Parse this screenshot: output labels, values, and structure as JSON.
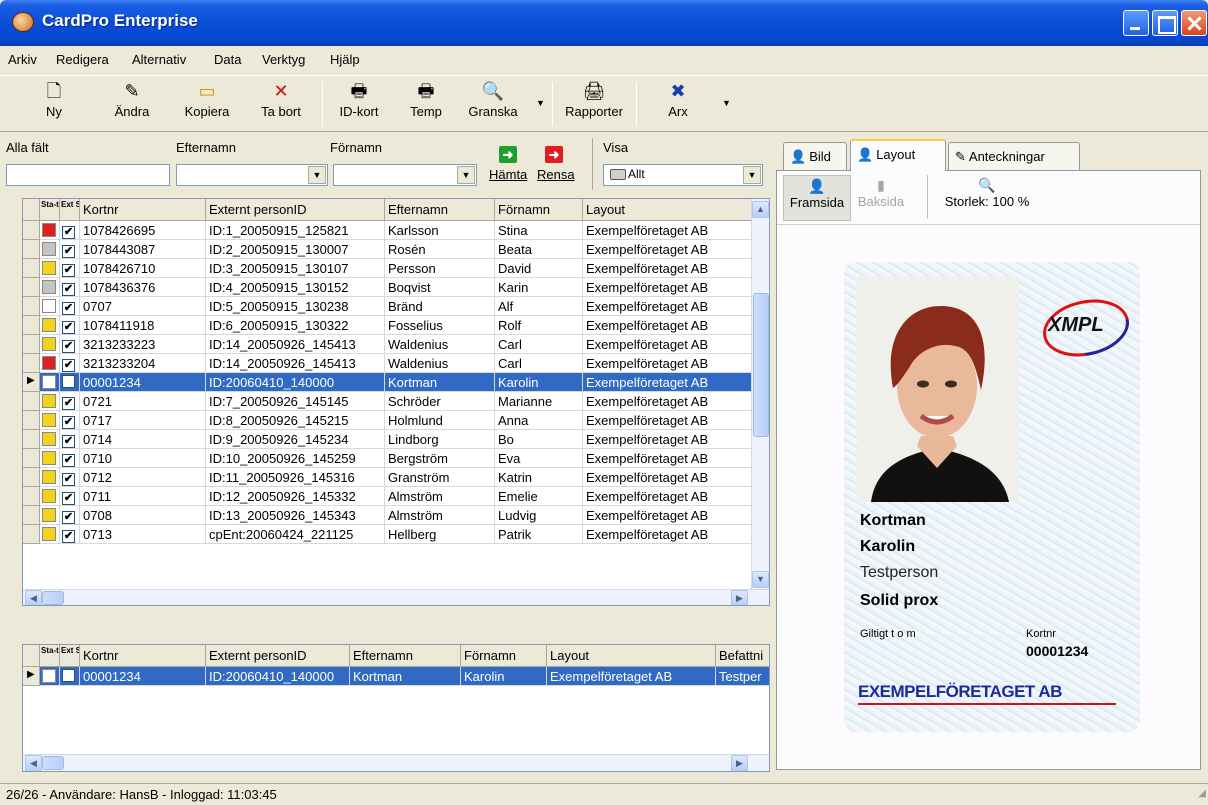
{
  "window": {
    "title": "CardPro Enterprise"
  },
  "menu": [
    "Arkiv",
    "Redigera",
    "Alternativ",
    "Data",
    "Verktyg",
    "Hjälp"
  ],
  "toolbar": {
    "new": "Ny",
    "edit": "Ändra",
    "copy": "Kopiera",
    "delete": "Ta bort",
    "idcard": "ID-kort",
    "temp": "Temp",
    "preview": "Granska",
    "reports": "Rapporter",
    "arx": "Arx"
  },
  "filter": {
    "all_fields_label": "Alla fält",
    "lastname_label": "Efternamn",
    "firstname_label": "Förnamn",
    "fetch": "Hämta",
    "clear": "Rensa",
    "show_label": "Visa",
    "show_value": "Allt"
  },
  "grid_headers": {
    "status": "Sta-tus",
    "ext_sync": "Ext Sync",
    "cardno": "Kortnr",
    "ext_id": "Externt personID",
    "lastname": "Efternamn",
    "firstname": "Förnamn",
    "layout": "Layout",
    "position": "Befattni"
  },
  "rows": [
    {
      "status": "red",
      "sync": "✔",
      "cardno": "1078426695",
      "ext_id": "ID:1_20050915_125821",
      "lastname": "Karlsson",
      "firstname": "Stina",
      "layout": "Exempelföretaget AB"
    },
    {
      "status": "grey",
      "sync": "✔",
      "cardno": "1078443087",
      "ext_id": "ID:2_20050915_130007",
      "lastname": "Rosén",
      "firstname": "Beata",
      "layout": "Exempelföretaget AB"
    },
    {
      "status": "yellow",
      "sync": "✔",
      "cardno": "1078426710",
      "ext_id": "ID:3_20050915_130107",
      "lastname": "Persson",
      "firstname": "David",
      "layout": "Exempelföretaget AB"
    },
    {
      "status": "grey",
      "sync": "✔",
      "cardno": "1078436376",
      "ext_id": "ID:4_20050915_130152",
      "lastname": "Boqvist",
      "firstname": "Karin",
      "layout": "Exempelföretaget AB"
    },
    {
      "status": "white",
      "sync": "✔",
      "cardno": "0707",
      "ext_id": "ID:5_20050915_130238",
      "lastname": "Bränd",
      "firstname": "Alf",
      "layout": "Exempelföretaget AB"
    },
    {
      "status": "yellow",
      "sync": "✔",
      "cardno": "1078411918",
      "ext_id": "ID:6_20050915_130322",
      "lastname": "Fosselius",
      "firstname": "Rolf",
      "layout": "Exempelföretaget AB"
    },
    {
      "status": "warn",
      "sync": "✔",
      "cardno": "3213233223",
      "ext_id": "ID:14_20050926_145413",
      "lastname": "Waldenius",
      "firstname": "Carl",
      "layout": "Exempelföretaget AB"
    },
    {
      "status": "red",
      "sync": "✔",
      "cardno": "3213233204",
      "ext_id": "ID:14_20050926_145413",
      "lastname": "Waldenius",
      "firstname": "Carl",
      "layout": "Exempelföretaget AB"
    },
    {
      "status": "white",
      "sync": "",
      "cardno": "00001234",
      "ext_id": "ID:20060410_140000",
      "lastname": "Kortman",
      "firstname": "Karolin",
      "layout": "Exempelföretaget AB",
      "selected": true
    },
    {
      "status": "yellow",
      "sync": "✔",
      "cardno": "0721",
      "ext_id": "ID:7_20050926_145145",
      "lastname": "Schröder",
      "firstname": "Marianne",
      "layout": "Exempelföretaget AB"
    },
    {
      "status": "yellow",
      "sync": "✔",
      "cardno": "0717",
      "ext_id": "ID:8_20050926_145215",
      "lastname": "Holmlund",
      "firstname": "Anna",
      "layout": "Exempelföretaget AB"
    },
    {
      "status": "yellow",
      "sync": "✔",
      "cardno": "0714",
      "ext_id": "ID:9_20050926_145234",
      "lastname": "Lindborg",
      "firstname": "Bo",
      "layout": "Exempelföretaget AB"
    },
    {
      "status": "yellow",
      "sync": "✔",
      "cardno": "0710",
      "ext_id": "ID:10_20050926_145259",
      "lastname": "Bergström",
      "firstname": "Eva",
      "layout": "Exempelföretaget AB"
    },
    {
      "status": "yellow",
      "sync": "✔",
      "cardno": "0712",
      "ext_id": "ID:11_20050926_145316",
      "lastname": "Granström",
      "firstname": "Katrin",
      "layout": "Exempelföretaget AB"
    },
    {
      "status": "yellow",
      "sync": "✔",
      "cardno": "0711",
      "ext_id": "ID:12_20050926_145332",
      "lastname": "Almström",
      "firstname": "Emelie",
      "layout": "Exempelföretaget AB"
    },
    {
      "status": "yellow",
      "sync": "✔",
      "cardno": "0708",
      "ext_id": "ID:13_20050926_145343",
      "lastname": "Almström",
      "firstname": "Ludvig",
      "layout": "Exempelföretaget AB"
    },
    {
      "status": "yellow",
      "sync": "✔",
      "cardno": "0713",
      "ext_id": "cpEnt:20060424_221125",
      "lastname": "Hellberg",
      "firstname": "Patrik",
      "layout": "Exempelföretaget AB"
    }
  ],
  "bottom_row": {
    "status": "white",
    "sync": "",
    "cardno": "00001234",
    "ext_id": "ID:20060410_140000",
    "lastname": "Kortman",
    "firstname": "Karolin",
    "layout": "Exempelföretaget AB",
    "position": "Testper"
  },
  "tabs": {
    "image": "Bild",
    "layout": "Layout",
    "notes": "Anteckningar"
  },
  "layout_toolbar": {
    "front": "Framsida",
    "back": "Baksida",
    "size": "Storlek: 100 %"
  },
  "card": {
    "logo": "XMPL",
    "lastname": "Kortman",
    "firstname": "Karolin",
    "title": "Testperson",
    "type": "Solid prox",
    "valid_label": "Giltigt t o m",
    "cardno_label": "Kortnr",
    "cardno": "00001234",
    "company": "EXEMPELFÖRETAGET AB"
  },
  "status": "26/26 - Användare: HansB - Inloggad: 11:03:45",
  "colors": {
    "selection": "#316ac5",
    "titlebar": "#0a4ed8",
    "company_text": "#1a2a9c",
    "company_line": "#d0101a"
  }
}
